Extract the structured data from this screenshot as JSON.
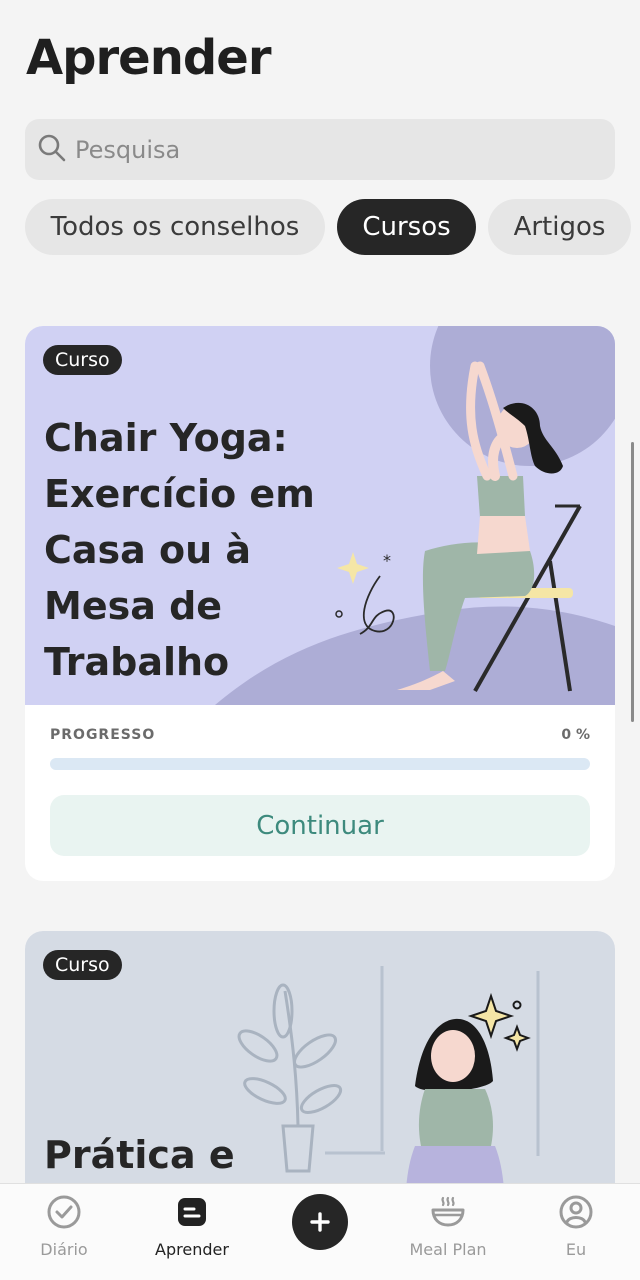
{
  "header": {
    "title": "Aprender"
  },
  "search": {
    "placeholder": "Pesquisa"
  },
  "filters": [
    {
      "label": "Todos os conselhos",
      "active": false
    },
    {
      "label": "Cursos",
      "active": true
    },
    {
      "label": "Artigos",
      "active": false
    }
  ],
  "cards": [
    {
      "badge": "Curso",
      "title": "Chair Yoga:\nExercício em\nCasa ou à\nMesa de\nTrabalho",
      "progress_label": "PROGRESSO",
      "progress_value": "0 %",
      "progress_fraction": 0,
      "button_label": "Continuar"
    },
    {
      "badge": "Curso",
      "title": "Prática e"
    }
  ],
  "tabbar": {
    "items": [
      {
        "label": "Diário",
        "icon": "check-circle-icon"
      },
      {
        "label": "Aprender",
        "icon": "learn-icon"
      },
      {
        "label": "",
        "icon": "plus-icon"
      },
      {
        "label": "Meal Plan",
        "icon": "bowl-icon"
      },
      {
        "label": "Eu",
        "icon": "profile-icon"
      }
    ]
  },
  "colors": {
    "accent": "#3d8a7d",
    "card1_bg": "#d0d1f3",
    "card2_bg": "#d5dbe4",
    "chip_active": "#262626"
  }
}
